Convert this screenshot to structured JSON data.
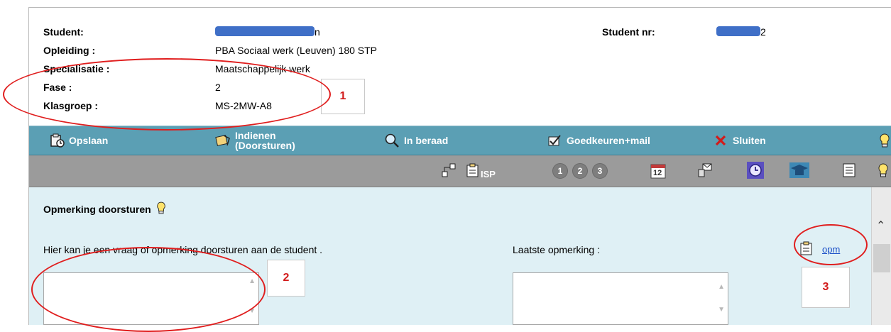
{
  "student_info": {
    "student_label": "Student:",
    "opleiding_label": "Opleiding :",
    "opleiding_value": "PBA Sociaal werk (Leuven) 180 STP",
    "specialisatie_label": "Specialisatie :",
    "specialisatie_value": "Maatschappelijk werk",
    "fase_label": "Fase :",
    "fase_value": "2",
    "klasgroep_label": "Klasgroep :",
    "klasgroep_value": "MS-2MW-A8",
    "student_nr_label": "Student nr:",
    "student_name_tail": "n",
    "student_nr_tail": "2"
  },
  "toolbar": {
    "opslaan": "Opslaan",
    "indienen_line1": "Indienen",
    "indienen_line2": "(Doorsturen)",
    "in_beraad": "In beraad",
    "goedkeuren": "Goedkeuren+mail",
    "sluiten": "Sluiten"
  },
  "iconbar": {
    "isp": "ISP",
    "step1": "1",
    "step2": "2",
    "step3": "3",
    "calendar_day": "12"
  },
  "panel": {
    "title": "Opmerking doorsturen",
    "question_text": "Hier kan je een vraag of opmerking doorsturen aan de student .",
    "laatste_label": "Laatste opmerking :",
    "opm_link": "opm"
  },
  "annotations": {
    "a1": "1",
    "a2": "2",
    "a3": "3"
  },
  "colors": {
    "toolbar": "#5b9fb4",
    "iconbar": "#9b9b9b",
    "panel": "#dff0f5",
    "redaction": "#3f6fc7",
    "annotation": "#e01e1e"
  }
}
